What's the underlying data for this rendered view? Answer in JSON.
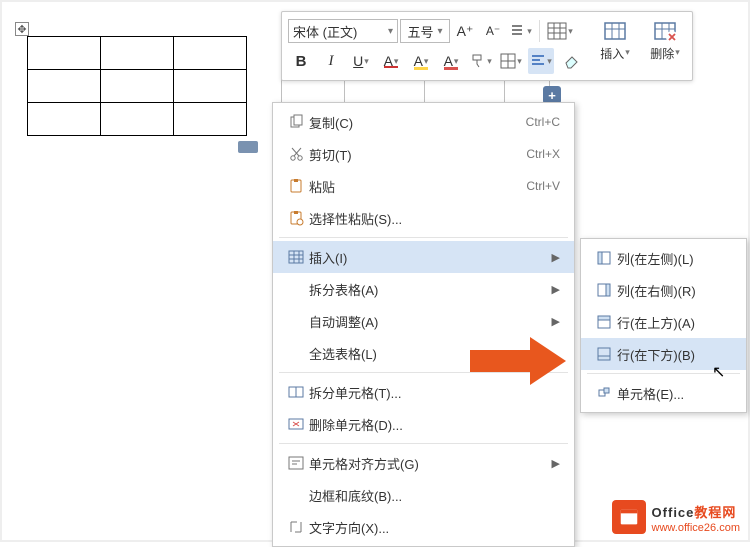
{
  "toolbar": {
    "font_name": "宋体 (正文)",
    "font_size": "五号",
    "increase_font": "A⁺",
    "decrease_font": "A⁻",
    "bold": "B",
    "italic": "I",
    "underline": "U",
    "strike": "A",
    "highlight": "A",
    "fontcolor": "A",
    "insert_label": "插入",
    "delete_label": "删除"
  },
  "context_menu": {
    "items": [
      {
        "icon": "copy",
        "label": "复制(C)",
        "shortcut": "Ctrl+C"
      },
      {
        "icon": "cut",
        "label": "剪切(T)",
        "shortcut": "Ctrl+X"
      },
      {
        "icon": "paste",
        "label": "粘贴",
        "shortcut": "Ctrl+V"
      },
      {
        "icon": "paste-special",
        "label": "选择性粘贴(S)...",
        "shortcut": ""
      },
      {
        "sep": true
      },
      {
        "icon": "table",
        "label": "插入(I)",
        "shortcut": "",
        "sub": true,
        "hover": true
      },
      {
        "icon": "",
        "label": "拆分表格(A)",
        "shortcut": "",
        "sub": true
      },
      {
        "icon": "",
        "label": "自动调整(A)",
        "shortcut": "",
        "sub": true
      },
      {
        "icon": "",
        "label": "全选表格(L)",
        "shortcut": ""
      },
      {
        "sep": true
      },
      {
        "icon": "split-cell",
        "label": "拆分单元格(T)...",
        "shortcut": ""
      },
      {
        "icon": "delete-cell",
        "label": "删除单元格(D)...",
        "shortcut": ""
      },
      {
        "sep": true
      },
      {
        "icon": "align",
        "label": "单元格对齐方式(G)",
        "shortcut": "",
        "sub": true
      },
      {
        "icon": "",
        "label": "边框和底纹(B)...",
        "shortcut": ""
      },
      {
        "icon": "text-dir",
        "label": "文字方向(X)...",
        "shortcut": ""
      }
    ]
  },
  "submenu": {
    "items": [
      {
        "icon": "col-left",
        "label": "列(在左侧)(L)"
      },
      {
        "icon": "col-right",
        "label": "列(在右侧)(R)"
      },
      {
        "icon": "row-above",
        "label": "行(在上方)(A)"
      },
      {
        "icon": "row-below",
        "label": "行(在下方)(B)",
        "hover": true
      },
      {
        "sep": true
      },
      {
        "icon": "cell",
        "label": "单元格(E)..."
      }
    ]
  },
  "watermark": {
    "brand_en": "Office",
    "brand_zh": "教程网",
    "url": "www.office26.com"
  }
}
